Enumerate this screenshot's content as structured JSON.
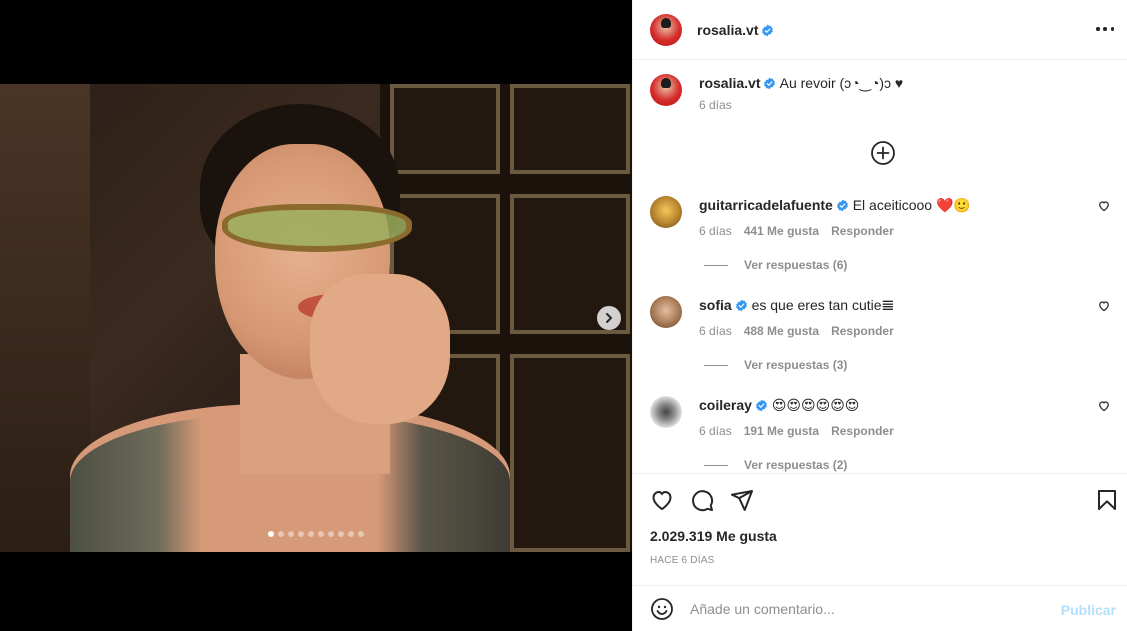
{
  "post": {
    "author": "rosalia.vt",
    "caption": "Au revoir (ɔ◔‿◔)ɔ ♥",
    "caption_time": "6 días",
    "carousel": {
      "count": 10,
      "active_index": 0
    }
  },
  "comments": [
    {
      "user": "guitarricadelafuente",
      "text": "El aceiticooo ❤️🙂",
      "time": "6 días",
      "likes": "441 Me gusta",
      "reply": "Responder",
      "view_replies": "Ver respuestas (6)",
      "avatar_color": "#6b5a2a"
    },
    {
      "user": "sofia",
      "text": "es que eres tan cutie𝌆",
      "time": "6 días",
      "likes": "488 Me gusta",
      "reply": "Responder",
      "view_replies": "Ver respuestas (3)",
      "avatar_color": "#8a6a4c"
    },
    {
      "user": "coileray",
      "text": "😍😍😍😍😍😍",
      "time": "6 días",
      "likes": "191 Me gusta",
      "reply": "Responder",
      "view_replies": "Ver respuestas (2)",
      "avatar_color": "#dddddd"
    }
  ],
  "stats": {
    "likes": "2.029.319 Me gusta",
    "time": "HACE 6 DÍAS"
  },
  "composer": {
    "placeholder": "Añade un comentario...",
    "publish": "Publicar"
  },
  "colors": {
    "verified": "#3897f0",
    "publish_disabled": "#b2dffc",
    "secondary_text": "#8e8e8e"
  }
}
